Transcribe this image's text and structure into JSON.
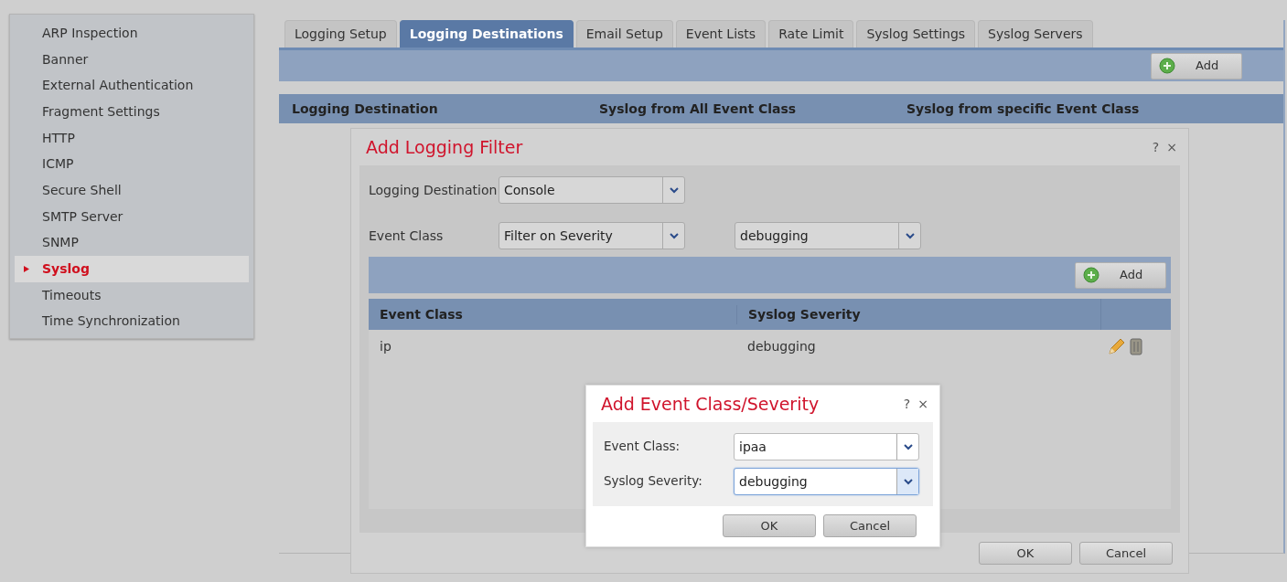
{
  "sidebar": {
    "items": [
      {
        "label": "ARP Inspection",
        "selected": false
      },
      {
        "label": "Banner",
        "selected": false
      },
      {
        "label": "External Authentication",
        "selected": false
      },
      {
        "label": "Fragment Settings",
        "selected": false
      },
      {
        "label": "HTTP",
        "selected": false
      },
      {
        "label": "ICMP",
        "selected": false
      },
      {
        "label": "Secure Shell",
        "selected": false
      },
      {
        "label": "SMTP Server",
        "selected": false
      },
      {
        "label": "SNMP",
        "selected": false
      },
      {
        "label": "Syslog",
        "selected": true
      },
      {
        "label": "Timeouts",
        "selected": false
      },
      {
        "label": "Time Synchronization",
        "selected": false
      }
    ]
  },
  "tabs": [
    {
      "label": "Logging Setup",
      "selected": false
    },
    {
      "label": "Logging Destinations",
      "selected": true
    },
    {
      "label": "Email Setup",
      "selected": false
    },
    {
      "label": "Event Lists",
      "selected": false
    },
    {
      "label": "Rate Limit",
      "selected": false
    },
    {
      "label": "Syslog Settings",
      "selected": false
    },
    {
      "label": "Syslog Servers",
      "selected": false
    }
  ],
  "toolbar": {
    "add_button": "Add"
  },
  "table": {
    "columns": [
      "Logging Destination",
      "Syslog from All Event Class",
      "Syslog from specific Event Class"
    ]
  },
  "logging_filter_dialog": {
    "title": "Add Logging Filter",
    "help": "?",
    "close": "×",
    "fields": [
      {
        "label": "Logging Destination",
        "values": [
          "Console"
        ]
      },
      {
        "label": "Event Class",
        "values": [
          "Filter on Severity",
          "debugging"
        ]
      }
    ],
    "toolbar": {
      "add_button": "Add"
    },
    "table": {
      "columns": [
        "Event Class",
        "Syslog Severity"
      ],
      "rows": [
        {
          "cells": [
            "ip",
            "debugging"
          ]
        }
      ]
    },
    "buttons": [
      "OK",
      "Cancel"
    ]
  },
  "event_class_dialog": {
    "title": "Add Event Class/Severity",
    "help": "?",
    "close": "×",
    "fields": [
      {
        "label": "Event Class:",
        "value": "ipaa",
        "focused": false
      },
      {
        "label": "Syslog Severity:",
        "value": "debugging",
        "focused": true
      }
    ],
    "buttons": [
      "OK",
      "Cancel"
    ]
  }
}
